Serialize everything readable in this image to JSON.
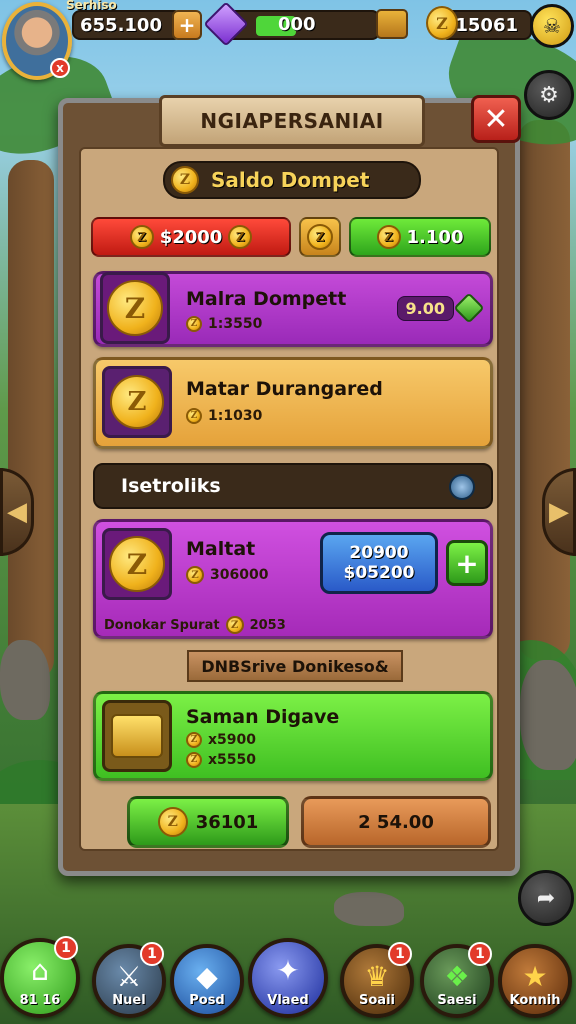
{
  "hud": {
    "player_name": "Serhiso",
    "avatar_badge": "x",
    "coins_left": "655.100",
    "xp_value": "000",
    "coins_right": "15061"
  },
  "panel": {
    "title": "NGIAPERSANIAI",
    "saldo_title": "Saldo Dompet",
    "balance_red": "$2000",
    "balance_green": "1.100",
    "card1": {
      "title": "Malra Dompett",
      "sub": "1:3550",
      "price": "9.00"
    },
    "card2": {
      "title": "Matar Durangared",
      "sub": "1:1030"
    },
    "section_title": "Isetroliks",
    "card3": {
      "title": "Maltat",
      "sub": "306000",
      "btn_line1": "20900",
      "btn_line2": "$05200",
      "footer_label": "Donokar Spurat",
      "footer_value": "2053"
    },
    "ribbon": "DNBSrive Donikeso&",
    "card4": {
      "title": "Saman Digave",
      "line1": "x5900",
      "line2": "x5550"
    },
    "bottom_left": "36101",
    "bottom_right": "2 54.00"
  },
  "nav": {
    "items": [
      {
        "label": "81 16",
        "badge": "1",
        "color": "#45c23a",
        "icon": "home-icon"
      },
      {
        "label": "Nuel",
        "badge": "1",
        "color": "#3a5a7a",
        "icon": "sword-icon"
      },
      {
        "label": "Posd",
        "badge": "",
        "color": "#2a6ad0",
        "icon": "cube-icon"
      },
      {
        "label": "Vlaed",
        "badge": "",
        "color": "#2f3fc8",
        "icon": "crystal-icon"
      },
      {
        "label": "Soaii",
        "badge": "1",
        "color": "#7a4a1a",
        "icon": "crown-icon"
      },
      {
        "label": "Saesi",
        "badge": "1",
        "color": "#3a6a2a",
        "icon": "gift-icon"
      },
      {
        "label": "Konnih",
        "badge": "",
        "color": "#7a3a1a",
        "icon": "star-icon"
      }
    ]
  },
  "colors": {
    "panel_bg": "#c9a77c",
    "accent_gold": "#f7d35a",
    "purple_card": "#b13bcc",
    "green_card": "#5ed634"
  }
}
